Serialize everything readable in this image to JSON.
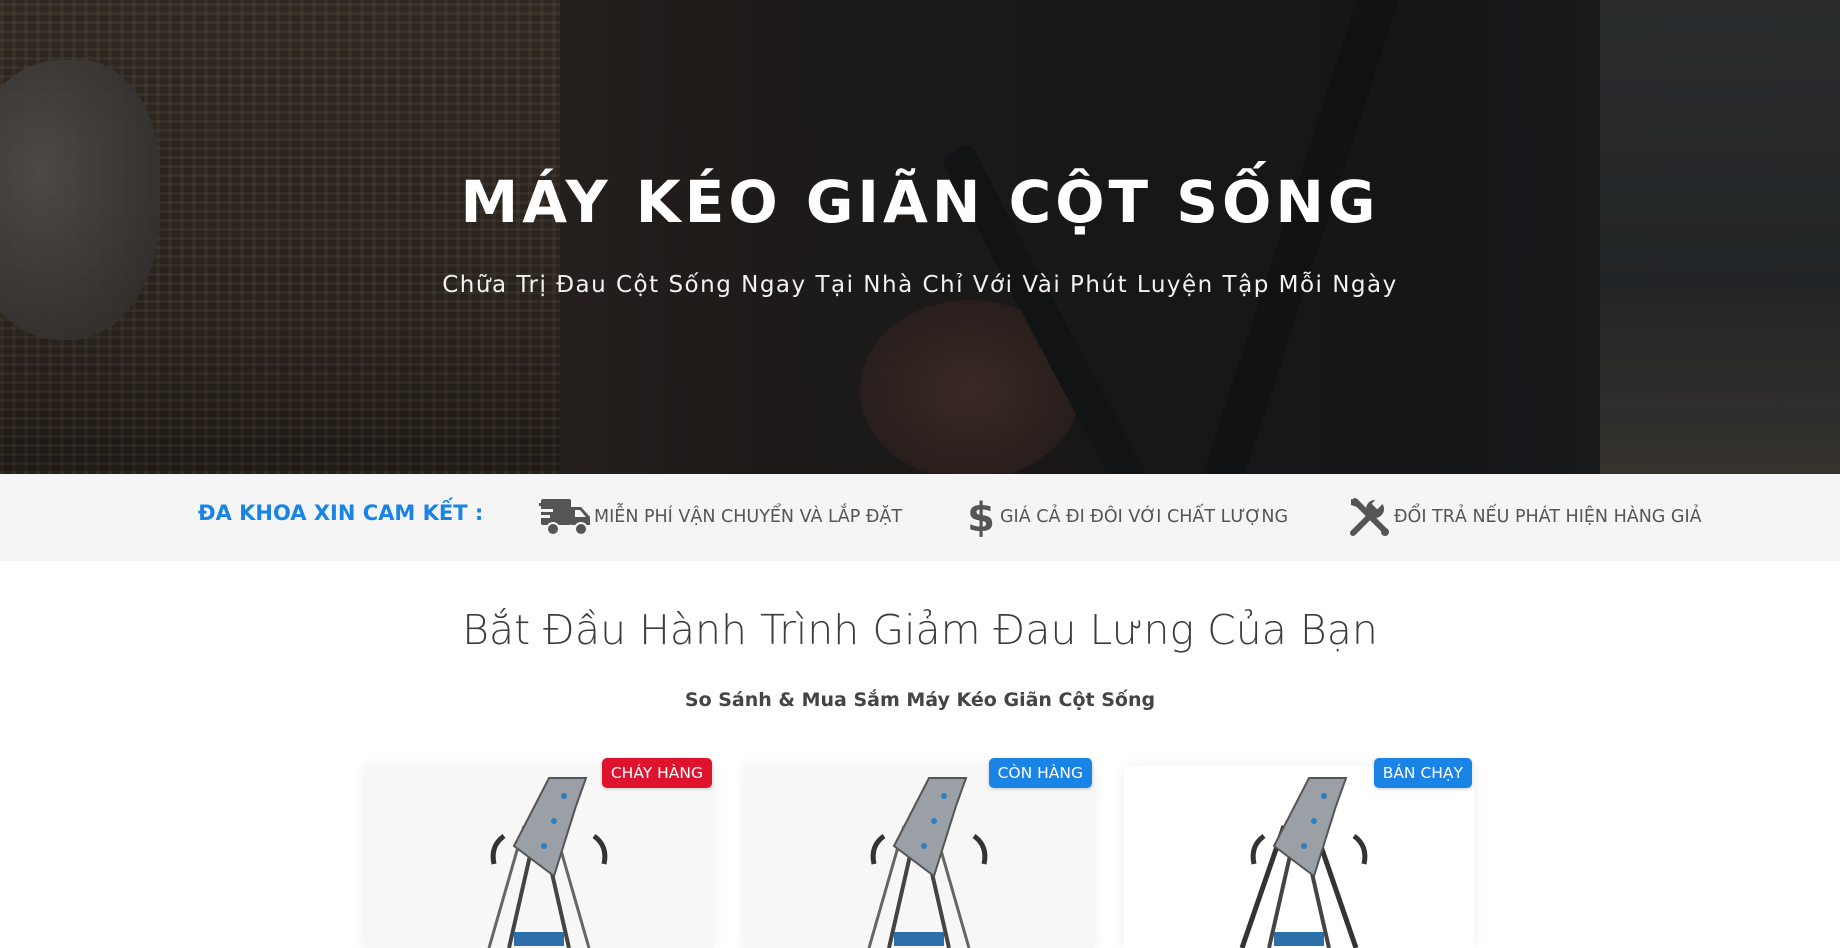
{
  "hero": {
    "title": "MÁY KÉO GIÃN CỘT SỐNG",
    "subtitle": "Chữa Trị Đau Cột Sống Ngay Tại Nhà Chỉ Với Vài Phút Luyện Tập Mỗi Ngày"
  },
  "commitments": {
    "title": "ĐA KHOA XIN CAM KẾT :",
    "items": [
      {
        "icon": "truck-icon",
        "label": "MIỄN PHÍ VẬN CHUYỂN VÀ LẮP ĐẶT"
      },
      {
        "icon": "dollar-icon",
        "label": "GIÁ CẢ ĐI ĐÔI VỚI CHẤT LƯỢNG"
      },
      {
        "icon": "tools-icon",
        "label": "ĐỔI TRẢ NẾU PHÁT HIỆN HÀNG GIẢ"
      }
    ]
  },
  "journey": {
    "title": "Bắt Đầu Hành Trình Giảm Đau Lưng Của Bạn",
    "subtitle": "So Sánh & Mua Sắm Máy Kéo Giãn Cột Sống"
  },
  "products": [
    {
      "badge": "CHÁY HÀNG",
      "badge_color": "#e0132f"
    },
    {
      "badge": "CÒN HÀNG",
      "badge_color": "#1a84e6"
    },
    {
      "badge": "BÁN CHẠY",
      "badge_color": "#1a84e6"
    }
  ],
  "colors": {
    "accent": "#1a84e6",
    "danger": "#e0132f",
    "commit_bar_bg": "#f5f5f5"
  }
}
